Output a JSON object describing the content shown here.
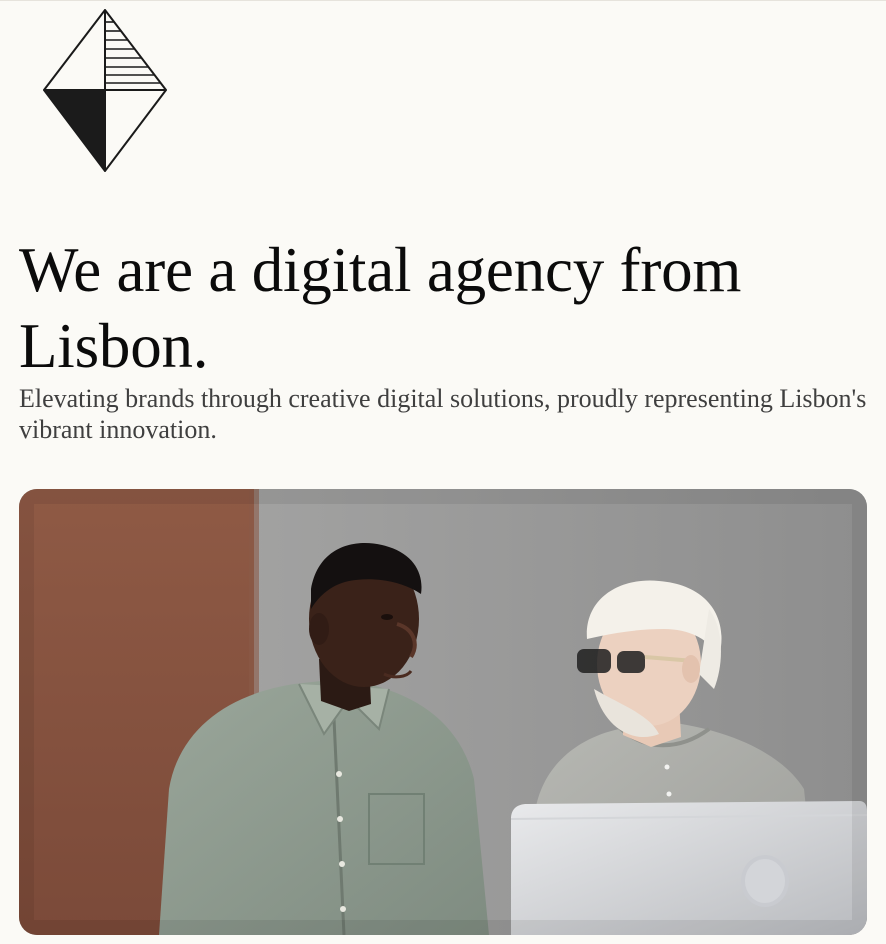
{
  "brand": {
    "logo_icon": "diamond-logo-icon"
  },
  "hero": {
    "headline": "We are a digital agency from Lisbon.",
    "subtitle": "Elevating brands through creative digital solutions, proudly representing Lisbon's vibrant innovation.",
    "image_icon": "team-photo"
  },
  "colors": {
    "background": "#fbfaf6",
    "text": "#0b0b0b",
    "subtext": "#3f3f3f"
  }
}
